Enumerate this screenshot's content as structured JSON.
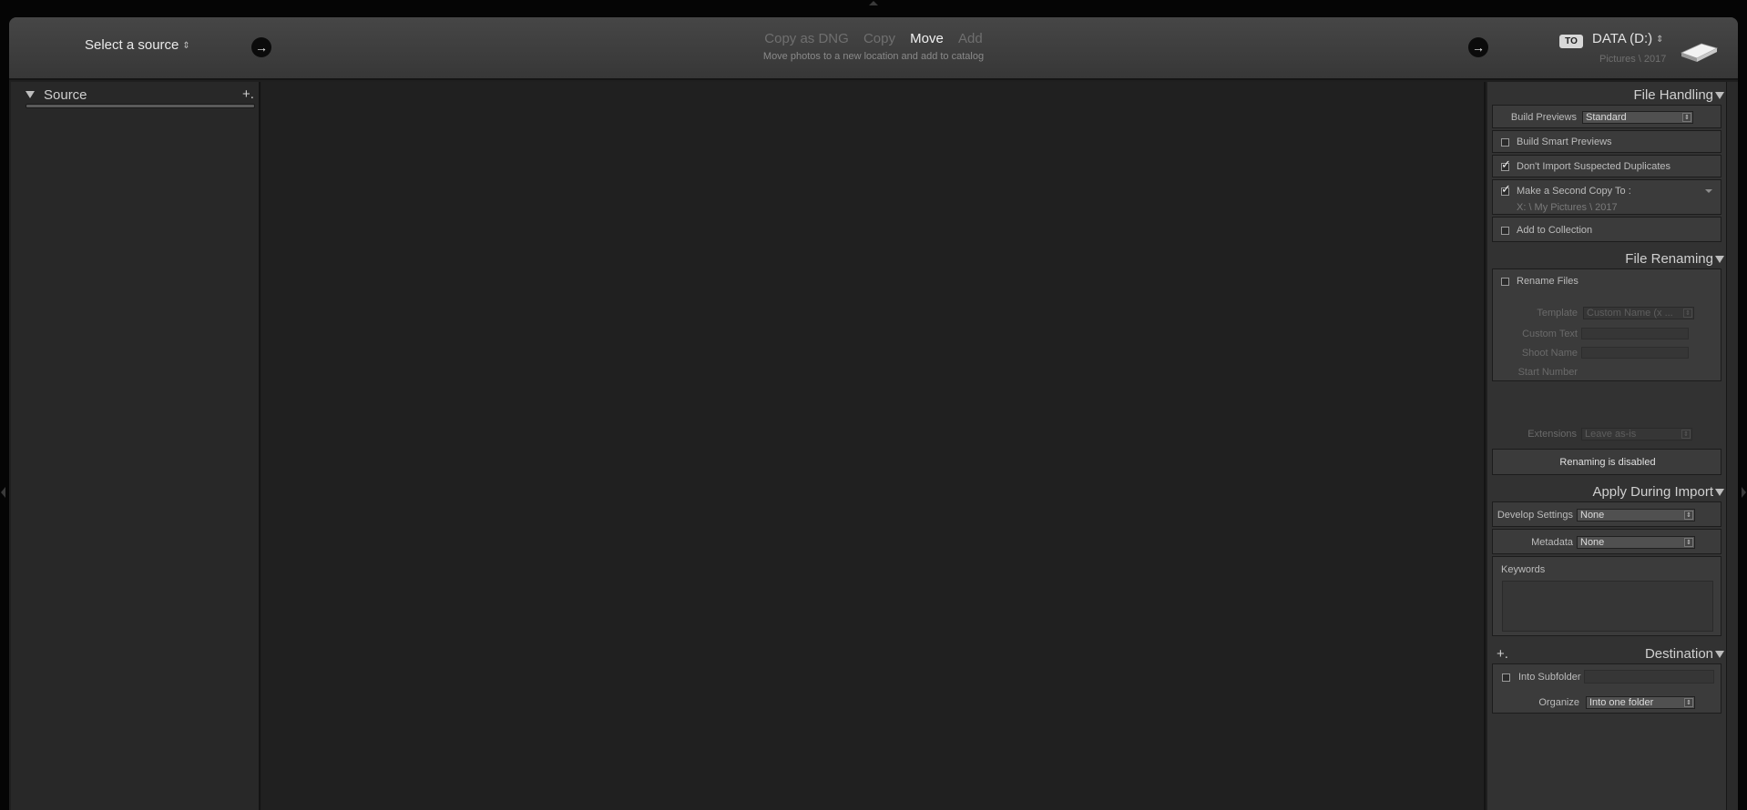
{
  "header": {
    "select_source": "Select a source",
    "modes": [
      {
        "label": "Copy as DNG",
        "active": false
      },
      {
        "label": "Copy",
        "active": false
      },
      {
        "label": "Move",
        "active": true
      },
      {
        "label": "Add",
        "active": false
      }
    ],
    "mode_description": "Move photos to a new location and add to catalog",
    "to_badge": "TO",
    "destination_name": "DATA (D:)",
    "destination_path": "Pictures \\ 2017"
  },
  "left_panel": {
    "title": "Source",
    "add_label": "+."
  },
  "file_handling": {
    "title": "File Handling",
    "build_previews_label": "Build Previews",
    "build_previews_value": "Standard",
    "build_smart_previews": {
      "label": "Build Smart Previews",
      "checked": false
    },
    "dont_import_duplicates": {
      "label": "Don't Import Suspected Duplicates",
      "checked": true
    },
    "second_copy": {
      "label": "Make a Second Copy To :",
      "checked": true,
      "path": "X: \\ My Pictures \\ 2017"
    },
    "add_to_collection": {
      "label": "Add to Collection",
      "checked": false
    }
  },
  "file_renaming": {
    "title": "File Renaming",
    "rename_files": {
      "label": "Rename Files",
      "checked": false
    },
    "template_label": "Template",
    "template_value": "Custom Name (x ...",
    "custom_text_label": "Custom Text",
    "shoot_name_label": "Shoot Name",
    "start_number_label": "Start Number",
    "extensions_label": "Extensions",
    "extensions_value": "Leave as-is",
    "disabled_message": "Renaming is disabled"
  },
  "apply_during_import": {
    "title": "Apply During Import",
    "develop_settings_label": "Develop Settings",
    "develop_settings_value": "None",
    "metadata_label": "Metadata",
    "metadata_value": "None",
    "keywords_label": "Keywords"
  },
  "destination": {
    "title": "Destination",
    "add_label": "+.",
    "into_subfolder": {
      "label": "Into Subfolder",
      "checked": false
    },
    "organize_label": "Organize",
    "organize_value": "Into one folder"
  },
  "icons": {
    "updown": "⇕",
    "arrow_right": "→",
    "select_arrow": "⇕"
  }
}
